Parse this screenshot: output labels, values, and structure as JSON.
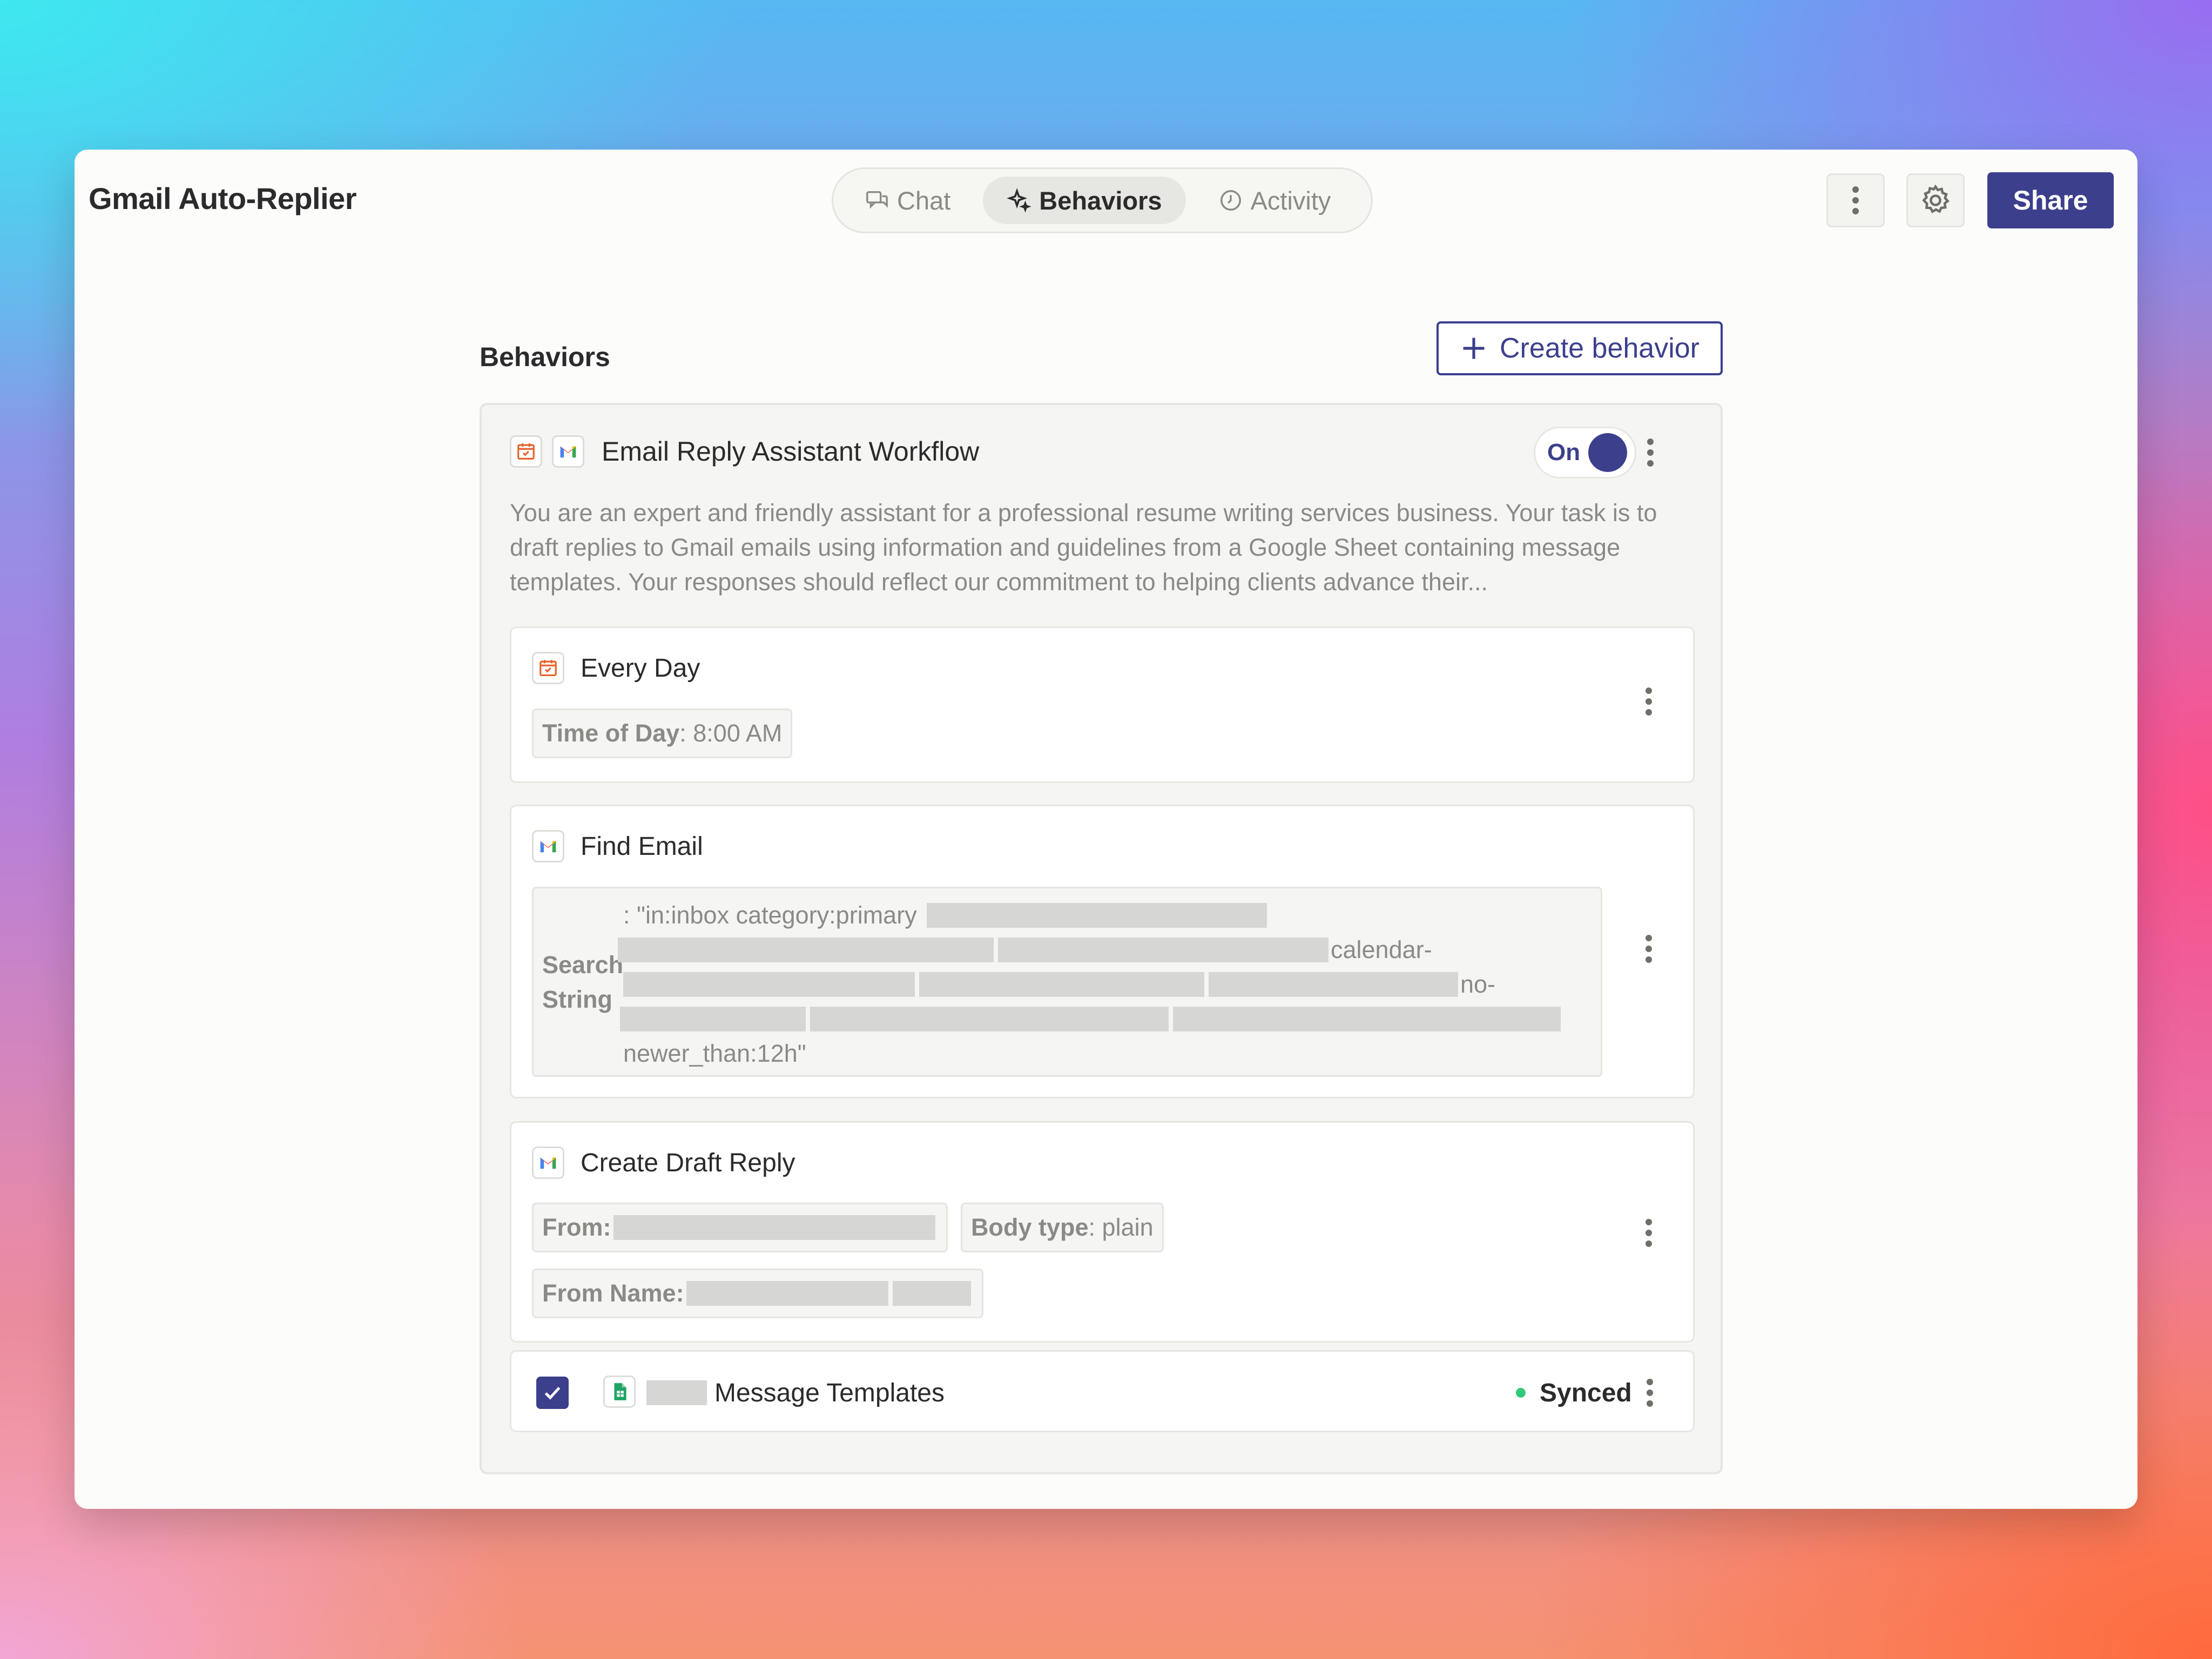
{
  "app": {
    "title": "Gmail Auto-Replier"
  },
  "tabs": [
    {
      "label": "Chat",
      "icon": "chat-icon",
      "active": false
    },
    {
      "label": "Behaviors",
      "icon": "sparkle-icon",
      "active": true
    },
    {
      "label": "Activity",
      "icon": "clock-icon",
      "active": false
    }
  ],
  "toolbar": {
    "share_label": "Share"
  },
  "section": {
    "title": "Behaviors",
    "create_label": "Create behavior"
  },
  "behavior": {
    "title": "Email Reply Assistant Workflow",
    "toggle_label": "On",
    "enabled": true,
    "description": "You are an expert and friendly assistant for a professional resume writing services business. Your task is to draft replies to Gmail emails using information and guidelines from a Google Sheet containing message templates. Your responses should reflect our commitment to helping clients advance their...",
    "steps": {
      "schedule": {
        "title": "Every Day",
        "time_label": "Time of Day",
        "time_value": "8:00 AM"
      },
      "find_email": {
        "title": "Find Email",
        "search_label_1": "Search",
        "search_label_2": "String",
        "line1": ": \"in:inbox category:primary",
        "line2_end": "calendar-",
        "line3_end": "no-",
        "line5": "newer_than:12h\""
      },
      "draft": {
        "title": "Create Draft Reply",
        "from_label": "From:",
        "body_type_label": "Body type",
        "body_type_value": "plain",
        "from_name_label": "From Name:"
      }
    },
    "knowledge": {
      "name": "Message Templates",
      "status": "Synced",
      "checked": true
    }
  },
  "colors": {
    "accent": "#3c3f8c",
    "synced": "#34c97a",
    "gmail_red": "#ea4335",
    "sheets_green": "#1fa463",
    "schedule_orange": "#e8622a"
  }
}
